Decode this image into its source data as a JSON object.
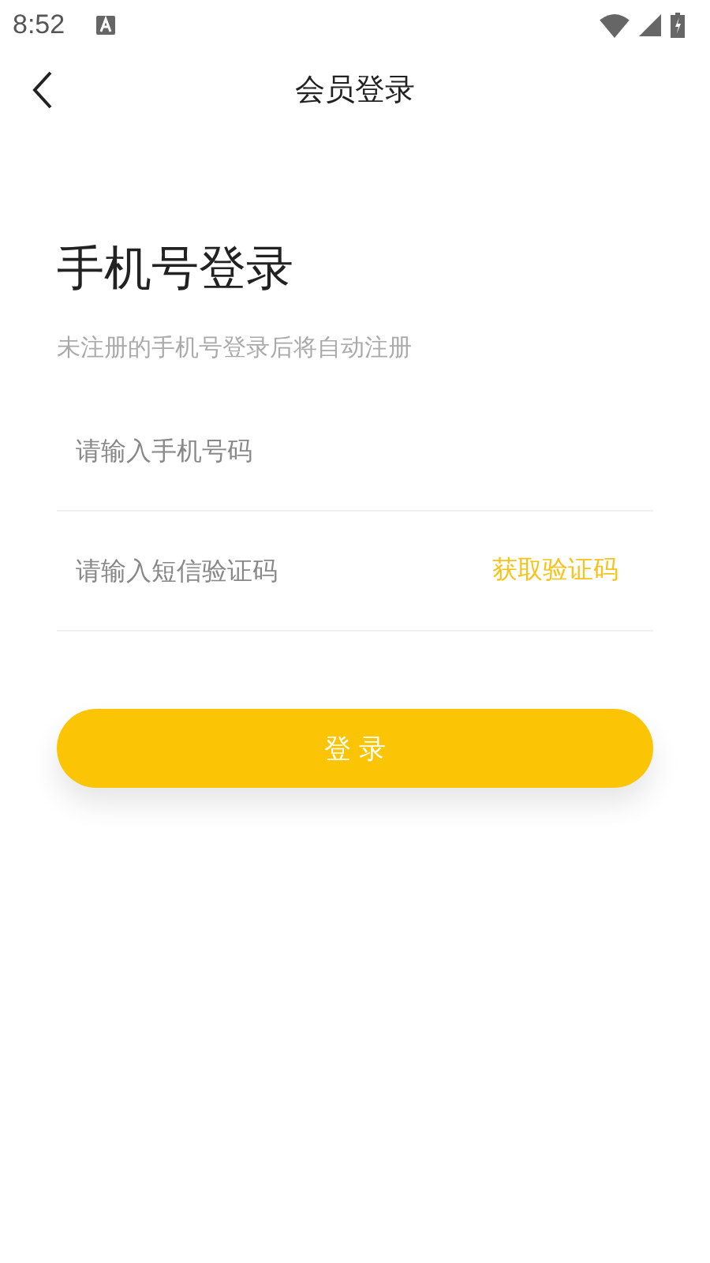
{
  "status_bar": {
    "time": "8:52"
  },
  "nav_bar": {
    "title": "会员登录"
  },
  "heading": "手机号登录",
  "subtitle": "未注册的手机号登录后将自动注册",
  "fields": [
    {
      "placeholder": "请输入手机号码"
    },
    {
      "placeholder": "请输入短信验证码",
      "action": "获取验证码"
    }
  ],
  "login_button": "登 录"
}
